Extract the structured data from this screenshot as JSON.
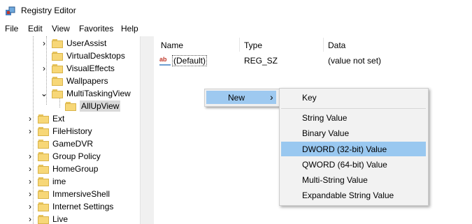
{
  "window": {
    "title": "Registry Editor",
    "icon": "registry-icon"
  },
  "menu": [
    "File",
    "Edit",
    "View",
    "Favorites",
    "Help"
  ],
  "tree": {
    "items": [
      {
        "label": "UserAssist",
        "expandable": true
      },
      {
        "label": "VirtualDesktops",
        "expandable": false
      },
      {
        "label": "VisualEffects",
        "expandable": true
      },
      {
        "label": "Wallpapers",
        "expandable": false
      },
      {
        "label": "MultiTaskingView",
        "expandable": true,
        "expanded": true
      },
      {
        "label": "AllUpView",
        "expandable": false,
        "selected": true
      },
      {
        "label": "Ext",
        "expandable": true
      },
      {
        "label": "FileHistory",
        "expandable": true
      },
      {
        "label": "GameDVR",
        "expandable": false
      },
      {
        "label": "Group Policy",
        "expandable": true
      },
      {
        "label": "HomeGroup",
        "expandable": true
      },
      {
        "label": "ime",
        "expandable": true
      },
      {
        "label": "ImmersiveShell",
        "expandable": true
      },
      {
        "label": "Internet Settings",
        "expandable": true
      },
      {
        "label": "Live",
        "expandable": true
      }
    ]
  },
  "list": {
    "columns": {
      "name": "Name",
      "type": "Type",
      "data": "Data"
    },
    "rows": [
      {
        "name": "(Default)",
        "type": "REG_SZ",
        "data": "(value not set)",
        "icon": "ab"
      }
    ]
  },
  "context_menu": {
    "new_label": "New",
    "submenu_arrow": "›"
  },
  "submenu": {
    "items": [
      "Key",
      "String Value",
      "Binary Value",
      "DWORD (32-bit) Value",
      "QWORD (64-bit) Value",
      "Multi-String Value",
      "Expandable String Value"
    ],
    "highlighted": "DWORD (32-bit) Value"
  },
  "colors": {
    "highlight": "#99c8f0",
    "folder": "#f7d777"
  }
}
